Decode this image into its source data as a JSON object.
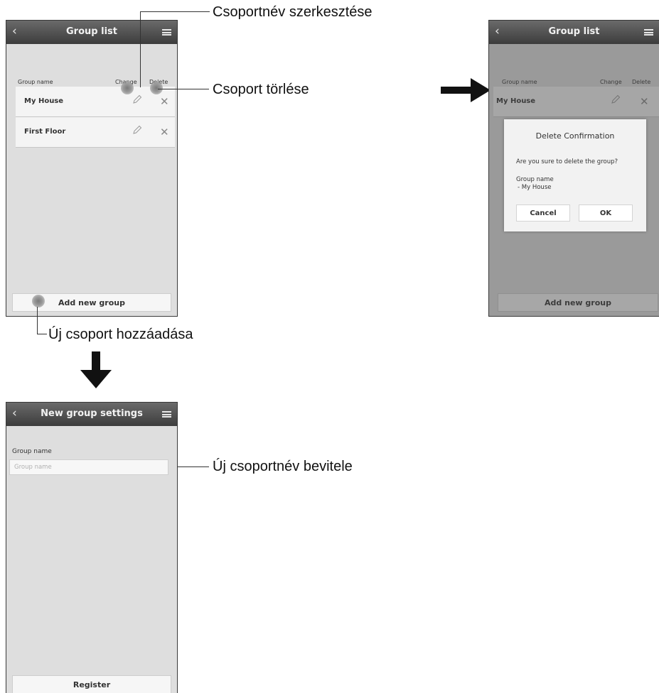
{
  "screen1": {
    "title": "Group list",
    "col_group_name": "Group name",
    "col_change": "Change",
    "col_delete": "Delete",
    "groups": [
      {
        "name": "My House"
      },
      {
        "name": "First Floor"
      }
    ],
    "add_button": "Add new group"
  },
  "screen2": {
    "title": "Group list",
    "col_group_name": "Group name",
    "col_change": "Change",
    "col_delete": "Delete",
    "row_name": "My House",
    "dialog": {
      "title": "Delete Confirmation",
      "message": "Are you sure to delete the group?",
      "label": "Group name",
      "value": "- My House",
      "cancel": "Cancel",
      "ok": "OK"
    },
    "add_button": "Add new group"
  },
  "screen3": {
    "title": "New group settings",
    "field_label": "Group name",
    "field_placeholder": "Group name",
    "register_button": "Register"
  },
  "callouts": {
    "edit_name": "Csoportnév szerkesztése",
    "delete_group": "Csoport törlése",
    "add_group": "Új csoport hozzáadása",
    "enter_name": "Új csoportnév bevitele"
  },
  "colors": {
    "topbar": "#4a4a4a",
    "screen_bg": "#dedede",
    "row_bg": "#f4f4f4"
  }
}
